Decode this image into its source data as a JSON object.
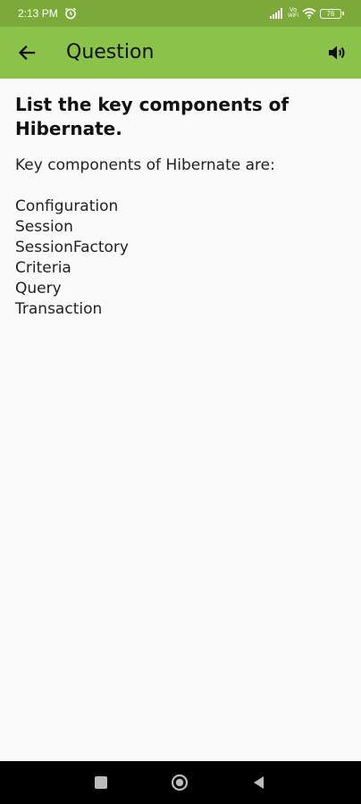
{
  "status_bar": {
    "time": "2:13 PM",
    "network_label": "Vo\nWiFi",
    "battery": "76"
  },
  "app_bar": {
    "title": "Question",
    "back_icon": "arrow-left-icon",
    "speaker_icon": "speaker-icon"
  },
  "question": {
    "title": "List the key components of Hibernate.",
    "intro": "Key components of Hibernate are:",
    "components": [
      "Configuration",
      "Session",
      "SessionFactory",
      "Criteria",
      "Query",
      "Transaction"
    ]
  },
  "colors": {
    "status_bar": "#7caa3a",
    "app_bar": "#8bc34a",
    "background": "#fafafa",
    "nav_bar": "#000000"
  }
}
